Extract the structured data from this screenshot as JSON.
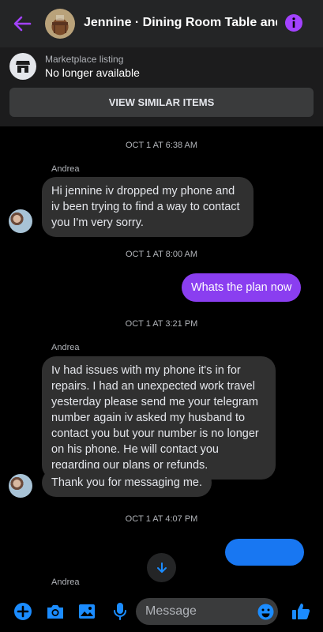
{
  "header": {
    "title": "Jennine · Dining Room Table and...",
    "accent": "#9b3ee8"
  },
  "listing": {
    "label": "Marketplace listing",
    "status": "No longer available",
    "button_label": "VIEW SIMILAR ITEMS"
  },
  "messages": {
    "ts1": "OCT 1 AT 6:38 AM",
    "sender1": "Andrea",
    "msg1": "Hi jennine iv dropped my phone and iv been trying to find a way to contact you I'm very sorry.",
    "ts2": "OCT 1 AT 8:00 AM",
    "msg2": "Whats the plan now",
    "ts3": "OCT 1 AT 3:21 PM",
    "sender2": "Andrea",
    "msg3": "Iv had issues with my phone it's in for repairs. I had an unexpected work travel yesterday please send me your telegram number again iv asked my husband to contact you but your number is no longer on his phone. He will contact you regarding our plans or refunds.",
    "msg4": "Thank you for messaging me.",
    "ts4": "OCT 1 AT 4:07 PM",
    "sender3": "Andrea"
  },
  "composer": {
    "placeholder": "Message"
  },
  "colors": {
    "outgoing_purple": "#8a3ef0",
    "outgoing_blue": "#1877f2",
    "icon_blue": "#1b8cff"
  }
}
